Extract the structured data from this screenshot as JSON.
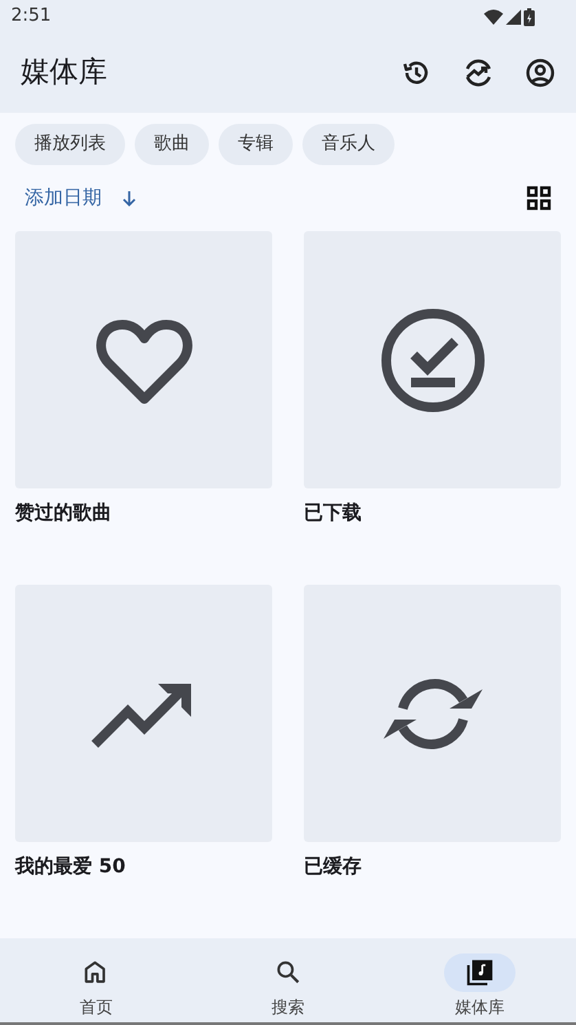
{
  "status_bar": {
    "time": "2:51"
  },
  "app_bar": {
    "title": "媒体库"
  },
  "chips": [
    {
      "label": "播放列表",
      "selected": false
    },
    {
      "label": "歌曲",
      "selected": false
    },
    {
      "label": "专辑",
      "selected": false
    },
    {
      "label": "音乐人",
      "selected": false
    }
  ],
  "sort": {
    "label": "添加日期"
  },
  "tiles": [
    {
      "kind": "liked",
      "label": "赞过的歌曲"
    },
    {
      "kind": "downloaded",
      "label": "已下载"
    },
    {
      "kind": "top",
      "label": "我的最爱 50"
    },
    {
      "kind": "cached",
      "label": "已缓存"
    }
  ],
  "nav": [
    {
      "kind": "home",
      "label": "首页",
      "selected": false
    },
    {
      "kind": "search",
      "label": "搜索",
      "selected": false
    },
    {
      "kind": "library",
      "label": "媒体库",
      "selected": true
    }
  ]
}
